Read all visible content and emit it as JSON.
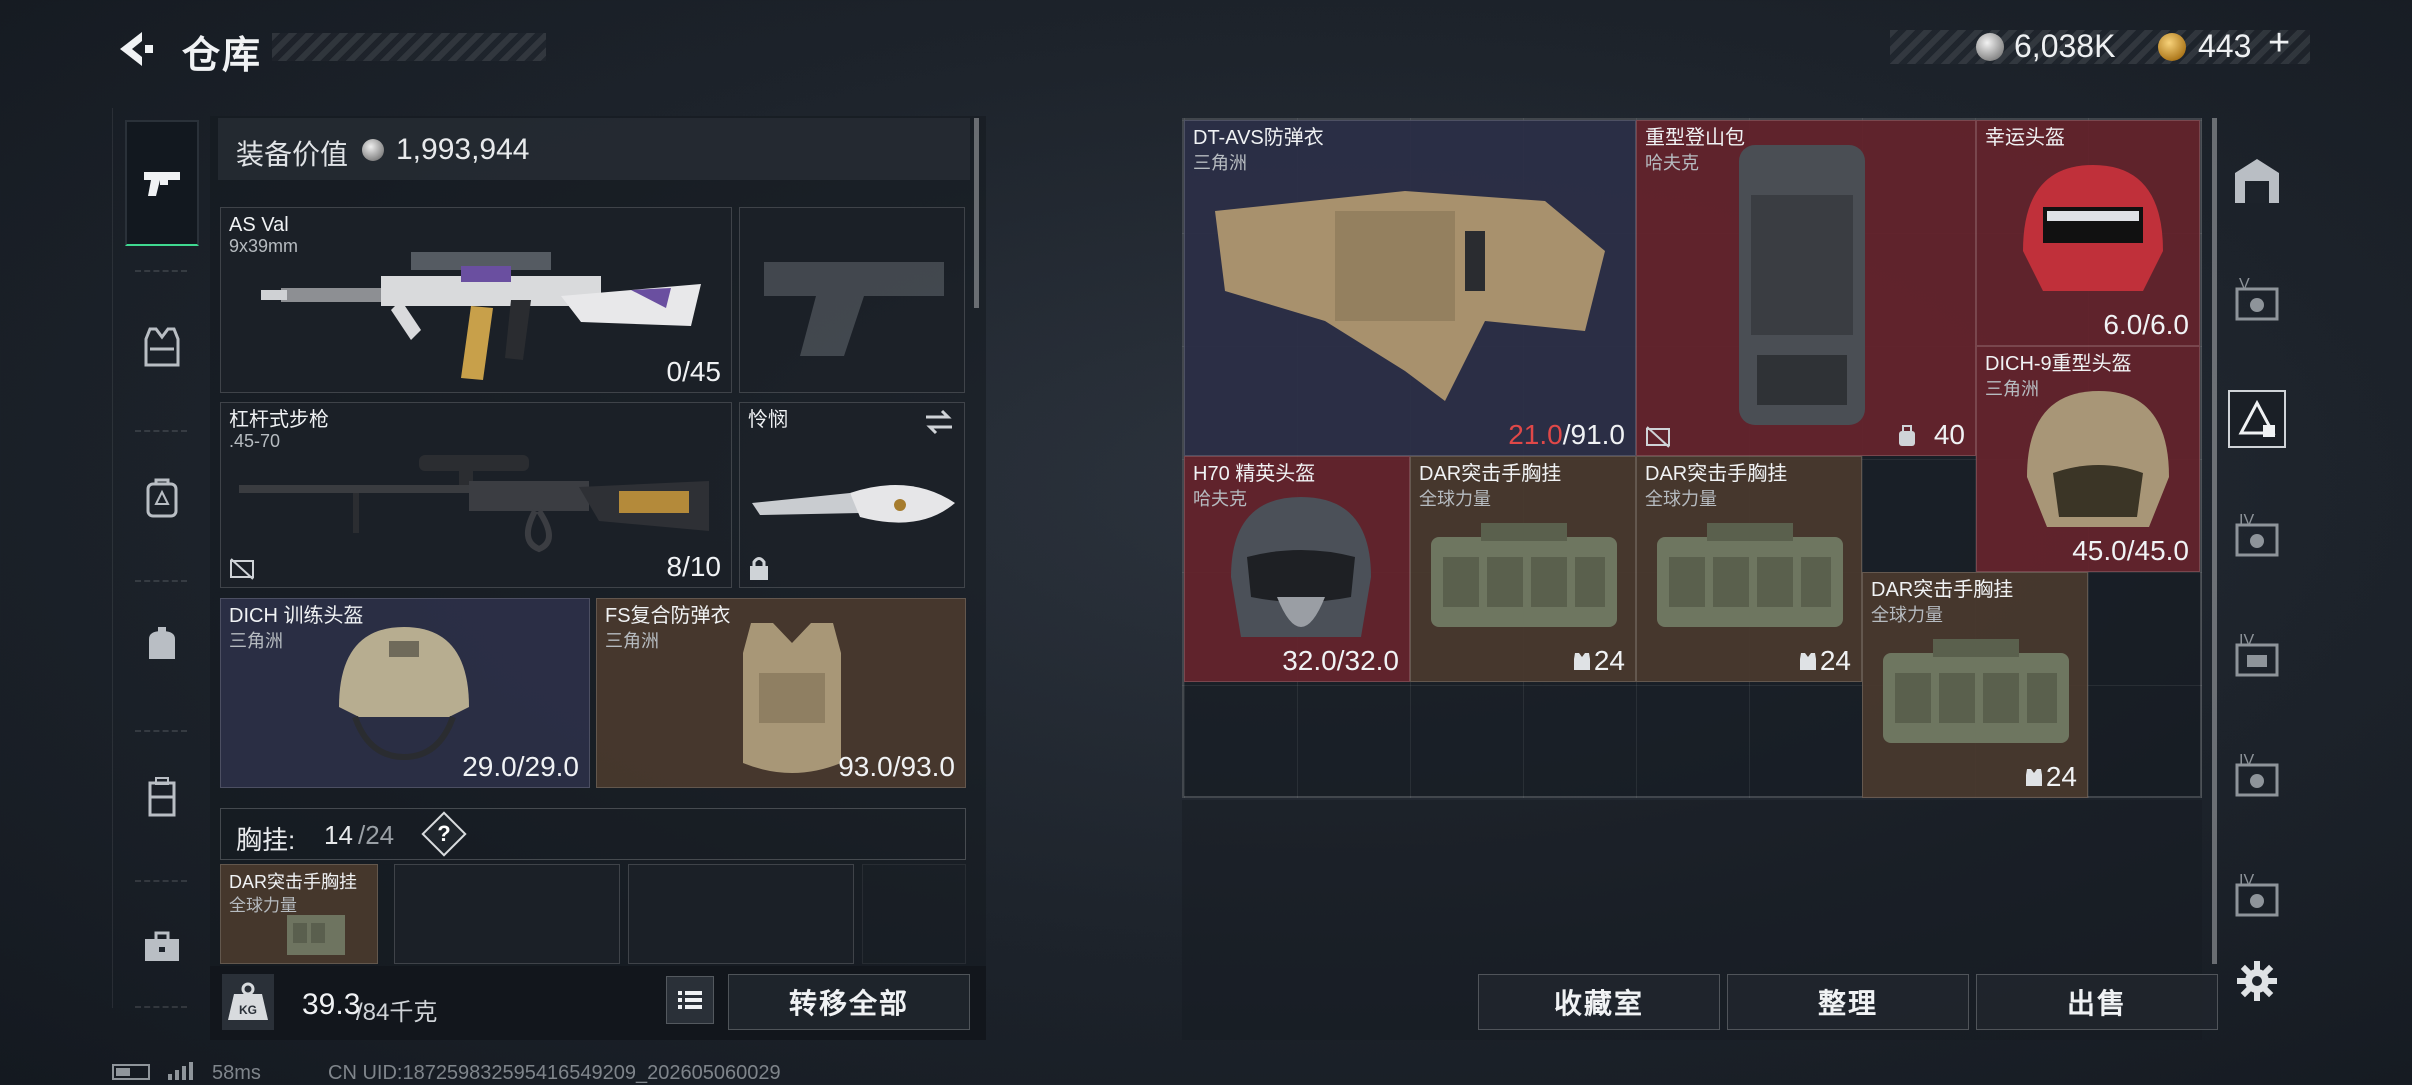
{
  "header": {
    "title": "仓库"
  },
  "currency": {
    "silver": "6,038K",
    "gold": "443",
    "gold_add": "+"
  },
  "left_rail": {
    "tabs": [
      "weapons",
      "armor",
      "backpack",
      "bag",
      "container",
      "toolbox"
    ]
  },
  "loadout": {
    "value_label": "装备价值",
    "value": "1,993,944",
    "slots": {
      "primary": {
        "name": "AS Val",
        "sub": "9x39mm",
        "count": "0/45"
      },
      "pistol": {
        "name": "",
        "sub": "",
        "count": ""
      },
      "secondary": {
        "name": "杠杆式步枪",
        "sub": ".45-70",
        "count": "8/10"
      },
      "melee": {
        "name": "怜悯",
        "sub": "",
        "count": ""
      },
      "helmet": {
        "name": "DICH 训练头盔",
        "sub": "三角洲",
        "count": "29.0/29.0"
      },
      "armor": {
        "name": "FS复合防弹衣",
        "sub": "三角洲",
        "count": "93.0/93.0"
      }
    },
    "rig": {
      "label": "胸挂:",
      "count": "14",
      "total": "/24",
      "help": "?"
    },
    "rig_item": {
      "name": "DAR突击手胸挂",
      "sub": "全球力量"
    },
    "weight": "39.3",
    "weight_max": "/84千克",
    "transfer_all": "转移全部"
  },
  "stash": {
    "items": [
      {
        "name": "DT-AVS防弹衣",
        "sub": "三角洲",
        "durability_current": "21.0",
        "durability_max": "/91.0"
      },
      {
        "name": "重型登山包",
        "sub": "哈夫克",
        "count": "40"
      },
      {
        "name": "幸运头盔",
        "sub": "",
        "count": "6.0/6.0"
      },
      {
        "name": "DICH-9重型头盔",
        "sub": "三角洲",
        "count": "45.0/45.0"
      },
      {
        "name": "H70 精英头盔",
        "sub": "哈夫克",
        "count": "32.0/32.0"
      },
      {
        "name": "DAR突击手胸挂",
        "sub": "全球力量",
        "count": "24"
      },
      {
        "name": "DAR突击手胸挂",
        "sub": "全球力量",
        "count": "24"
      },
      {
        "name": "DAR突击手胸挂",
        "sub": "全球力量",
        "count": "24"
      }
    ],
    "buttons": {
      "stash_room": "收藏室",
      "organize": "整理",
      "sell": "出售"
    }
  },
  "right_rail": {
    "labels": [
      "V",
      "IV",
      "IV",
      "IV",
      "IV"
    ]
  },
  "status": {
    "ping": "58ms",
    "uid": "CN UID:18725983259541654920​9_202605060029"
  }
}
